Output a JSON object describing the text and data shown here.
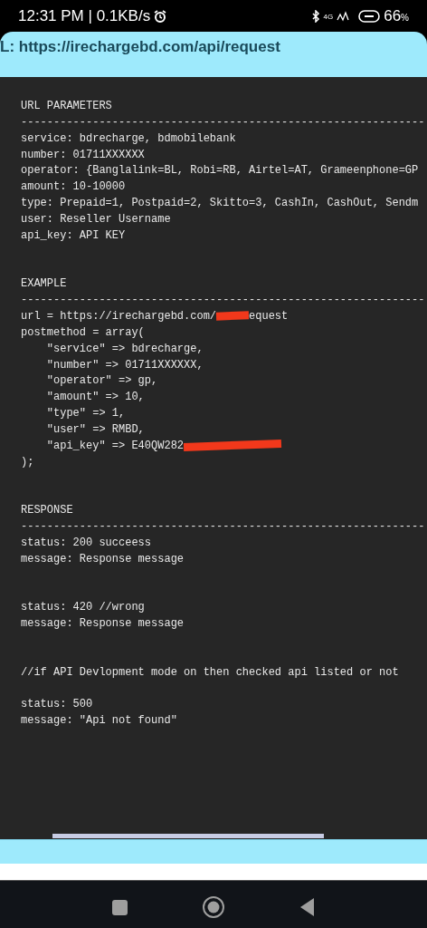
{
  "status_bar": {
    "time": "12:31 PM | 0.1KB/s",
    "network": "4G",
    "battery": "66",
    "battery_unit": "%"
  },
  "url_bar": {
    "text": "L: https://irechargebd.com/api/request"
  },
  "code_lines": [
    {
      "kind": "text",
      "text": "URL PARAMETERS"
    },
    {
      "kind": "rule",
      "text": "--------------------------------------------------------------"
    },
    {
      "kind": "text",
      "text": "service: bdrecharge, bdmobilebank"
    },
    {
      "kind": "text",
      "text": "number: 01711XXXXXX"
    },
    {
      "kind": "text",
      "text": "operator: {Banglalink=BL, Robi=RB, Airtel=AT, Grameenphone=GP"
    },
    {
      "kind": "text",
      "text": "amount: 10-10000"
    },
    {
      "kind": "text",
      "text": "type: Prepaid=1, Postpaid=2, Skitto=3, CashIn, CashOut, Sendm"
    },
    {
      "kind": "text",
      "text": "user: Reseller Username"
    },
    {
      "kind": "text",
      "text": "api_key: API KEY"
    },
    {
      "kind": "blank"
    },
    {
      "kind": "blank"
    },
    {
      "kind": "text",
      "text": "EXAMPLE"
    },
    {
      "kind": "rule",
      "text": "--------------------------------------------------------------"
    },
    {
      "kind": "redacted",
      "text": "url = https://irechargebd.com/",
      "after": "equest"
    },
    {
      "kind": "text",
      "text": "postmethod = array("
    },
    {
      "kind": "text",
      "text": "    \"service\" => bdrecharge,"
    },
    {
      "kind": "text",
      "text": "    \"number\" => 01711XXXXXX,"
    },
    {
      "kind": "text",
      "text": "    \"operator\" => gp,"
    },
    {
      "kind": "text",
      "text": "    \"amount\" => 10,"
    },
    {
      "kind": "text",
      "text": "    \"type\" => 1,"
    },
    {
      "kind": "text",
      "text": "    \"user\" => RMBD,"
    },
    {
      "kind": "redacted",
      "text": "    \"api_key\" => E40QW282"
    },
    {
      "kind": "text",
      "text": ");"
    },
    {
      "kind": "blank"
    },
    {
      "kind": "blank"
    },
    {
      "kind": "text",
      "text": "RESPONSE"
    },
    {
      "kind": "rule",
      "text": "--------------------------------------------------------------"
    },
    {
      "kind": "text",
      "text": "status: 200 succeess"
    },
    {
      "kind": "text",
      "text": "message: Response message"
    },
    {
      "kind": "blank"
    },
    {
      "kind": "blank"
    },
    {
      "kind": "text",
      "text": "status: 420 //wrong"
    },
    {
      "kind": "text",
      "text": "message: Response message"
    },
    {
      "kind": "blank"
    },
    {
      "kind": "blank"
    },
    {
      "kind": "text",
      "text": "//if API Devlopment mode on then checked api listed or not"
    },
    {
      "kind": "blank"
    },
    {
      "kind": "text",
      "text": "status: 500"
    },
    {
      "kind": "text",
      "text": "message: \"Api not found\""
    }
  ]
}
